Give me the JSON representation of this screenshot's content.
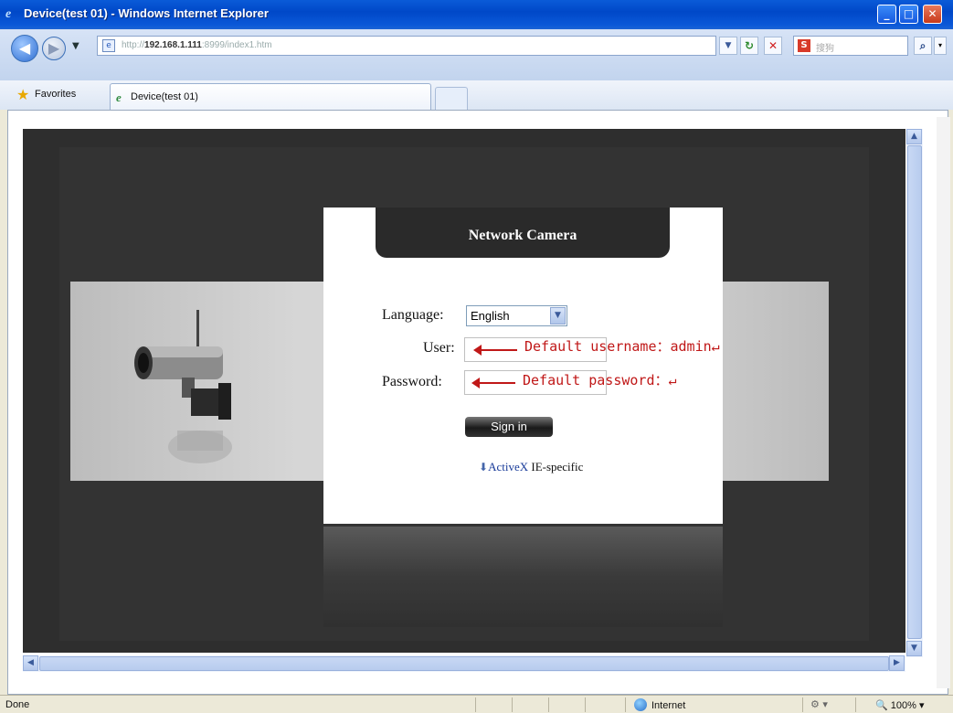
{
  "window": {
    "title": "Device(test 01) - Windows Internet Explorer"
  },
  "address": {
    "url_prefix": "http://",
    "url_host": "192.168.1.111",
    "url_suffix": ":8999/index1.htm",
    "search_placeholder": "搜狗"
  },
  "favorites": {
    "label": "Favorites"
  },
  "tab": {
    "label": "Device(test 01)"
  },
  "panel": {
    "title": "Network Camera",
    "language_label": "Language:",
    "language_value": "English",
    "user_label": "User:",
    "password_label": "Password:",
    "signin_label": "Sign in",
    "activex_label": "ActiveX",
    "ie_specific_label": "IE-specific"
  },
  "annotations": {
    "user_note": "Default username：admin↵",
    "password_note": "Default password：↵"
  },
  "status": {
    "done": "Done",
    "zone": "Internet",
    "zoom": "100%"
  },
  "icons": [
    "ie-icon",
    "back-icon",
    "forward-icon",
    "dropdown-icon",
    "page-icon",
    "refresh-icon",
    "stop-icon",
    "search-icon",
    "star-icon",
    "globe-icon",
    "camera-image"
  ]
}
